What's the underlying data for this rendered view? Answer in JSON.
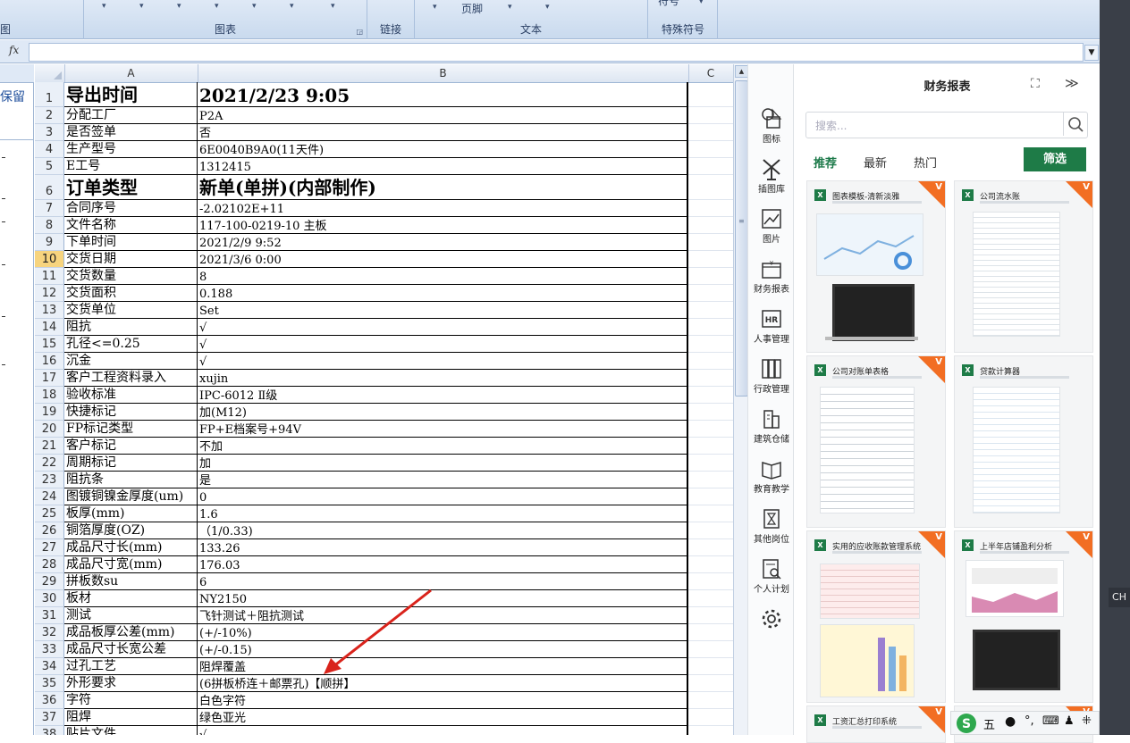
{
  "ribbon": {
    "groups": [
      {
        "label": "图"
      },
      {
        "label": "图表"
      },
      {
        "label": "链接"
      },
      {
        "label": "文本"
      },
      {
        "label": "特殊符号"
      }
    ],
    "footer_label": "页脚",
    "symbol_label": "符号"
  },
  "formula_bar": {
    "fx": "fx",
    "value": ""
  },
  "left_pane": {
    "keep_text": "保留"
  },
  "columns": [
    "A",
    "B",
    "C"
  ],
  "active_row": 10,
  "rows": [
    {
      "n": "1",
      "a": "导出时间",
      "b": "2021/2/23  9:05",
      "big": true
    },
    {
      "n": "2",
      "a": "分配工厂",
      "b": "P2A"
    },
    {
      "n": "3",
      "a": "是否签单",
      "b": "否"
    },
    {
      "n": "4",
      "a": "生产型号",
      "b": "6E0040B9A0(11天件)"
    },
    {
      "n": "5",
      "a": "E工号",
      "b": "1312415"
    },
    {
      "n": "6",
      "a": "订单类型",
      "b": "新单(单拼)(内部制作)",
      "big": true
    },
    {
      "n": "7",
      "a": "合同序号",
      "b": "-2.02102E+11"
    },
    {
      "n": "8",
      "a": "文件名称",
      "b": "117-100-0219-10 主板"
    },
    {
      "n": "9",
      "a": "下单时间",
      "b": "2021/2/9  9:52"
    },
    {
      "n": "10",
      "a": "交货日期",
      "b": "2021/3/6  0:00"
    },
    {
      "n": "11",
      "a": "交货数量",
      "b": "8"
    },
    {
      "n": "12",
      "a": "交货面积",
      "b": "0.188"
    },
    {
      "n": "13",
      "a": "交货单位",
      "b": "Set"
    },
    {
      "n": "14",
      "a": "阻抗",
      "b": "√"
    },
    {
      "n": "15",
      "a": "孔径<=0.25",
      "b": "√"
    },
    {
      "n": "16",
      "a": "沉金",
      "b": "√"
    },
    {
      "n": "17",
      "a": "客户工程资料录入",
      "b": "xujin"
    },
    {
      "n": "18",
      "a": "验收标准",
      "b": "IPC-6012 Ⅱ级"
    },
    {
      "n": "19",
      "a": "快捷标记",
      "b": "加(M12)"
    },
    {
      "n": "20",
      "a": "FP标记类型",
      "b": "FP+E档案号+94V"
    },
    {
      "n": "21",
      "a": "客户标记",
      "b": "不加"
    },
    {
      "n": "22",
      "a": "周期标记",
      "b": "加"
    },
    {
      "n": "23",
      "a": "阻抗条",
      "b": "是"
    },
    {
      "n": "24",
      "a": "图镀铜镍金厚度(um)",
      "b": "0"
    },
    {
      "n": "25",
      "a": "板厚(mm)",
      "b": "1.6"
    },
    {
      "n": "26",
      "a": "铜箔厚度(OZ)",
      "b": "（1/0.33)"
    },
    {
      "n": "27",
      "a": "成品尺寸长(mm)",
      "b": "133.26"
    },
    {
      "n": "28",
      "a": "成品尺寸宽(mm)",
      "b": "176.03"
    },
    {
      "n": "29",
      "a": "拼板数su",
      "b": "6"
    },
    {
      "n": "30",
      "a": "板材",
      "b": "NY2150"
    },
    {
      "n": "31",
      "a": "测试",
      "b": "飞针测试＋阻抗测试"
    },
    {
      "n": "32",
      "a": "成品板厚公差(mm)",
      "b": "(+/-10%)"
    },
    {
      "n": "33",
      "a": "成品尺寸长宽公差",
      "b": "(+/-0.15)"
    },
    {
      "n": "34",
      "a": "过孔工艺",
      "b": "阻焊覆盖"
    },
    {
      "n": "35",
      "a": "外形要求",
      "b": "(6拼板桥连＋邮票孔)【顺拼】"
    },
    {
      "n": "36",
      "a": "字符",
      "b": "白色字符"
    },
    {
      "n": "37",
      "a": "阻焊",
      "b": "绿色亚光"
    },
    {
      "n": "38",
      "a": "贴片文件",
      "b": "√"
    }
  ],
  "sidebar": {
    "items": [
      {
        "label": "图标",
        "icon": "shapes-icon"
      },
      {
        "label": "插图库",
        "icon": "windmill-icon"
      },
      {
        "label": "图片",
        "icon": "picture-icon"
      },
      {
        "label": "财务报表",
        "icon": "finance-icon"
      },
      {
        "label": "人事管理",
        "icon": "hr-icon"
      },
      {
        "label": "行政管理",
        "icon": "binders-icon"
      },
      {
        "label": "建筑仓储",
        "icon": "building-icon"
      },
      {
        "label": "教育教学",
        "icon": "book-icon"
      },
      {
        "label": "其他岗位",
        "icon": "hourglass-icon"
      },
      {
        "label": "个人计划",
        "icon": "plan-icon"
      },
      {
        "label": "",
        "icon": "gear-icon"
      }
    ]
  },
  "panel": {
    "title": "财务报表",
    "search_placeholder": "搜索...",
    "tabs": [
      "推荐",
      "最新",
      "热门"
    ],
    "filter_label": "筛选",
    "cards": [
      {
        "title": "图表模板-清新淡雅"
      },
      {
        "title": "公司流水账"
      },
      {
        "title": "公司对账单表格"
      },
      {
        "title": "贷款计算器"
      },
      {
        "title": "实用的应收账款管理系统"
      },
      {
        "title": "上半年店铺盈利分析"
      },
      {
        "title": "工资汇总打印系统"
      },
      {
        "title": ""
      }
    ]
  },
  "tray": {
    "ch": "CH",
    "ime_char": "五"
  },
  "colors": {
    "accent_green": "#1e7b47",
    "badge_orange": "#f26e23",
    "annotation_arrow": "#d9231b"
  }
}
